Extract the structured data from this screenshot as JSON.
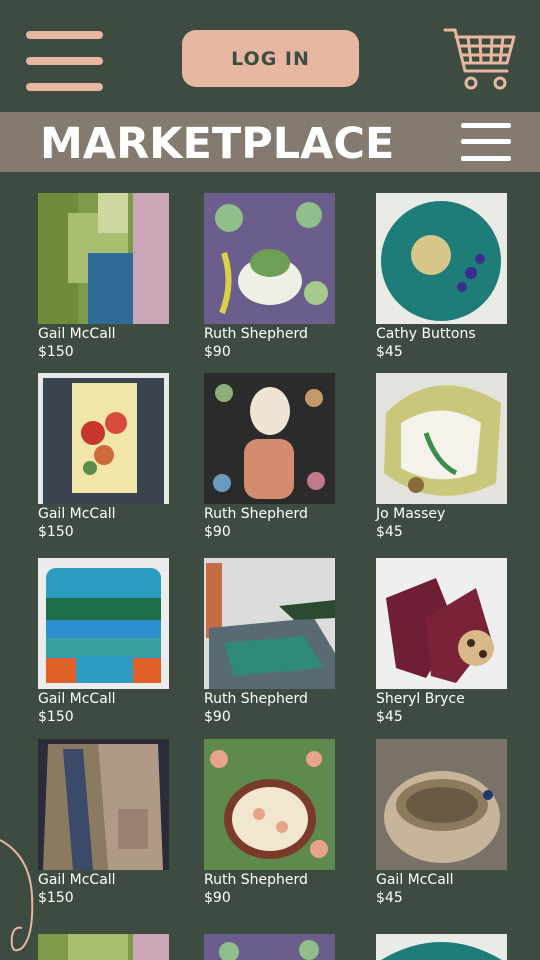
{
  "header": {
    "login_label": "LOG IN"
  },
  "page_title": "MARKETPLACE",
  "colors": {
    "background": "#3e4b40",
    "accent": "#e8b7a1",
    "title_bar": "#857a6f",
    "text": "#ffffff"
  },
  "icons": {
    "menu": "hamburger-menu-icon",
    "cart": "shopping-cart-icon",
    "filter": "filter-menu-icon"
  },
  "products": [
    {
      "seller": "Gail McCall",
      "price": "$150"
    },
    {
      "seller": "Ruth Shepherd",
      "price": "$90"
    },
    {
      "seller": "Cathy Buttons",
      "price": "$45"
    },
    {
      "seller": "Gail McCall",
      "price": "$150"
    },
    {
      "seller": "Ruth Shepherd",
      "price": "$90"
    },
    {
      "seller": "Jo Massey",
      "price": "$45"
    },
    {
      "seller": "Gail McCall",
      "price": "$150"
    },
    {
      "seller": "Ruth Shepherd",
      "price": "$90"
    },
    {
      "seller": "Sheryl Bryce",
      "price": "$45"
    },
    {
      "seller": "Gail McCall",
      "price": "$150"
    },
    {
      "seller": "Ruth Shepherd",
      "price": "$90"
    },
    {
      "seller": "Gail McCall",
      "price": "$45"
    }
  ]
}
